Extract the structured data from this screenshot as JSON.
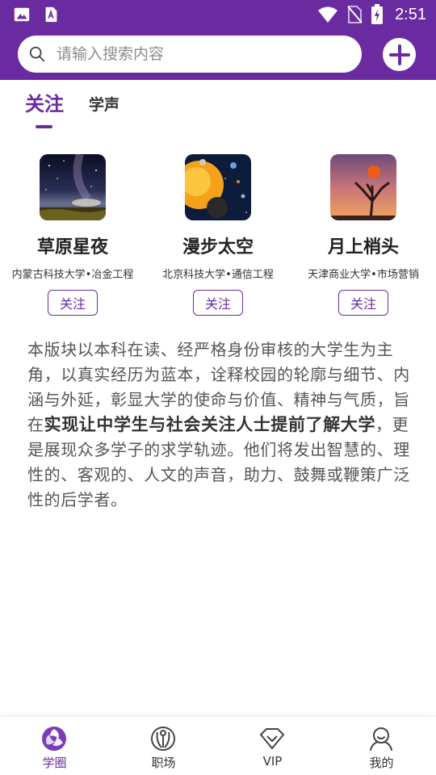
{
  "status_bar": {
    "time": "2:51",
    "left_icons": [
      "image-icon",
      "text-a-icon"
    ],
    "right_icons": [
      "wifi-icon",
      "no-sim-icon",
      "battery-charging-icon"
    ]
  },
  "search": {
    "placeholder": "请输入搜索内容",
    "value": ""
  },
  "add_button_icon": "plus-icon",
  "tabs": [
    {
      "label": "关注",
      "active": true
    },
    {
      "label": "学声",
      "active": false
    }
  ],
  "recommended": [
    {
      "name": "草原星夜",
      "school": "内蒙古科技大学•冶金工程",
      "follow_label": "关注",
      "thumb": "night-sky-image"
    },
    {
      "name": "漫步太空",
      "school": "北京科技大学•通信工程",
      "follow_label": "关注",
      "thumb": "solar-system-image"
    },
    {
      "name": "月上梢头",
      "school": "天津商业大学•市场营销",
      "follow_label": "关注",
      "thumb": "tree-sunset-image"
    }
  ],
  "description": {
    "part1": "本版块以本科在读、经严格身份审核的大学生为主角，以真实经历为蓝本，诠释校园的轮廓与细节、内涵与外延，彰显大学的使命与价值、精神与气质，旨在",
    "highlight": "实现让中学生与社会关注人士提前了解大学",
    "part2": "，更是展现众多学子的求学轨迹。他们将发出智慧的、理性的、客观的、人文的声音，助力、鼓舞或鞭策广泛性的后学者。"
  },
  "bottom_nav": [
    {
      "label": "学圈",
      "icon": "circle-logo-icon",
      "active": true
    },
    {
      "label": "职场",
      "icon": "career-icon",
      "active": false
    },
    {
      "label": "VIP",
      "icon": "diamond-icon",
      "active": false
    },
    {
      "label": "我的",
      "icon": "user-icon",
      "active": false
    }
  ],
  "colors": {
    "accent": "#6a2ba1",
    "background": "#ffffff"
  }
}
